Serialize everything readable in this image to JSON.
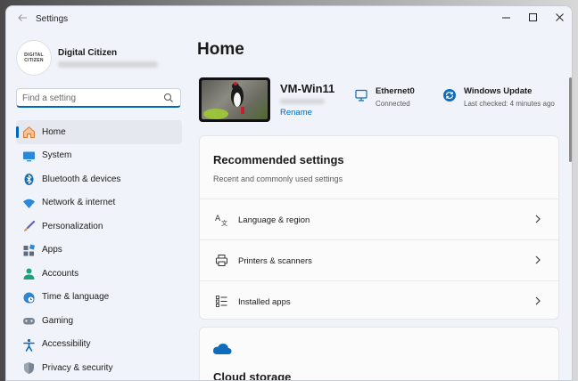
{
  "window": {
    "title": "Settings",
    "controls": {
      "minimize": "minimize",
      "maximize": "maximize",
      "close": "close"
    }
  },
  "profile": {
    "avatar_line1": "DIGITAL",
    "avatar_line2": "CITIZEN",
    "name": "Digital Citizen"
  },
  "search": {
    "placeholder": "Find a setting"
  },
  "nav": {
    "items": [
      {
        "label": "Home",
        "icon": "home-icon",
        "selected": true
      },
      {
        "label": "System",
        "icon": "monitor-icon"
      },
      {
        "label": "Bluetooth & devices",
        "icon": "bluetooth-icon"
      },
      {
        "label": "Network & internet",
        "icon": "wifi-icon"
      },
      {
        "label": "Personalization",
        "icon": "brush-icon"
      },
      {
        "label": "Apps",
        "icon": "apps-icon"
      },
      {
        "label": "Accounts",
        "icon": "person-icon"
      },
      {
        "label": "Time & language",
        "icon": "globe-clock-icon"
      },
      {
        "label": "Gaming",
        "icon": "gamepad-icon"
      },
      {
        "label": "Accessibility",
        "icon": "accessibility-icon"
      },
      {
        "label": "Privacy & security",
        "icon": "shield-icon"
      }
    ]
  },
  "main": {
    "title": "Home",
    "device": {
      "name": "VM-Win11",
      "rename": "Rename"
    },
    "ethernet": {
      "title": "Ethernet0",
      "detail": "Connected"
    },
    "update": {
      "title": "Windows Update",
      "detail": "Last checked: 4 minutes ago"
    },
    "recommended": {
      "title": "Recommended settings",
      "subtitle": "Recent and commonly used settings",
      "rows": [
        {
          "label": "Language & region",
          "icon": "language-icon"
        },
        {
          "label": "Printers & scanners",
          "icon": "printer-icon"
        },
        {
          "label": "Installed apps",
          "icon": "list-icon"
        }
      ]
    },
    "cloud": {
      "title": "Cloud storage"
    }
  },
  "colors": {
    "accent": "#0067c0",
    "onedrive": "#0f6cbd"
  }
}
